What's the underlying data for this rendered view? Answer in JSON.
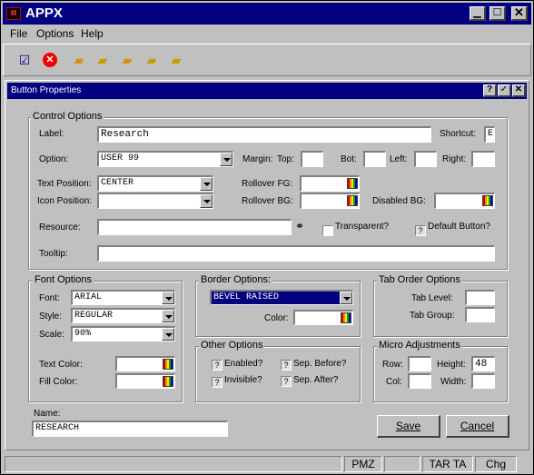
{
  "app": {
    "title": "APPX",
    "menu": [
      "File",
      "Options",
      "Help"
    ]
  },
  "dialog": {
    "title": "Button Properties"
  },
  "control_options": {
    "group_title": "Control Options",
    "label_caption": "Label:",
    "label_value": "Research",
    "shortcut_caption": "Shortcut:",
    "shortcut_value": "E",
    "option_caption": "Option:",
    "option_value": "USER 99",
    "margin_caption": "Margin:",
    "top_caption": "Top:",
    "bot_caption": "Bot:",
    "left_caption": "Left:",
    "right_caption": "Right:",
    "text_position_caption": "Text Position:",
    "text_position_value": "CENTER",
    "icon_position_caption": "Icon Position:",
    "icon_position_value": "",
    "rollover_fg_caption": "Rollover FG:",
    "rollover_bg_caption": "Rollover BG:",
    "disabled_bg_caption": "Disabled BG:",
    "resource_caption": "Resource:",
    "transparent_caption": "Transparent?",
    "default_button_caption": "Default Button?",
    "tooltip_caption": "Tooltip:"
  },
  "font_options": {
    "group_title": "Font Options",
    "font_caption": "Font:",
    "font_value": "ARIAL",
    "style_caption": "Style:",
    "style_value": "REGULAR",
    "scale_caption": "Scale:",
    "scale_value": "90%",
    "text_color_caption": "Text Color:",
    "fill_color_caption": "Fill Color:"
  },
  "border_options": {
    "group_title": "Border Options:",
    "border_value": "BEVEL RAISED",
    "color_caption": "Color:"
  },
  "tab_order_options": {
    "group_title": "Tab Order Options",
    "tab_level_caption": "Tab Level:",
    "tab_group_caption": "Tab Group:"
  },
  "other_options": {
    "group_title": "Other Options",
    "enabled_caption": "Enabled?",
    "invisible_caption": "Invisible?",
    "sep_before_caption": "Sep. Before?",
    "sep_after_caption": "Sep. After?"
  },
  "micro_adjustments": {
    "group_title": "Micro Adjustments",
    "row_caption": "Row:",
    "col_caption": "Col:",
    "height_caption": "Height:",
    "height_value": "48",
    "width_caption": "Width:"
  },
  "name": {
    "caption": "Name:",
    "value": "RESEARCH"
  },
  "buttons": {
    "save": "Save",
    "cancel": "Cancel"
  },
  "status_bar": [
    "PMZ",
    "",
    "TAR TA",
    "Chg"
  ],
  "colors": {
    "titlebar": "#000080",
    "face": "#c0c0c0"
  }
}
